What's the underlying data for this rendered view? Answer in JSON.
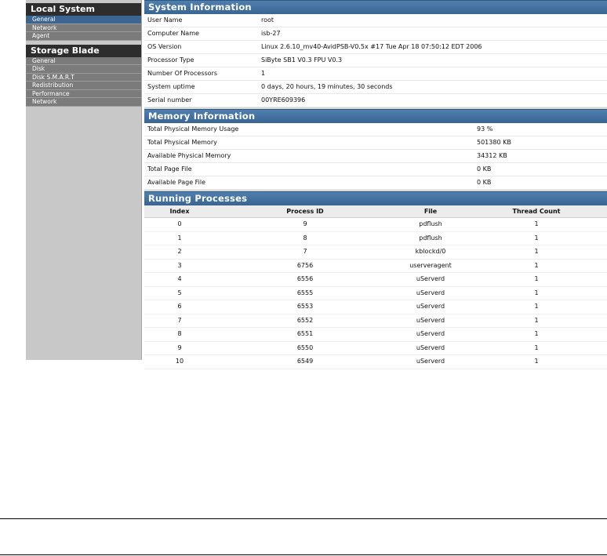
{
  "nav": {
    "local_system": {
      "heading": "Local System",
      "items": [
        {
          "label": "General",
          "active": true
        },
        {
          "label": "Network",
          "active": false
        },
        {
          "label": "Agent",
          "active": false
        }
      ]
    },
    "storage_blade": {
      "heading": "Storage Blade",
      "items": [
        {
          "label": "General"
        },
        {
          "label": "Disk"
        },
        {
          "label": "Disk S.M.A.R.T"
        },
        {
          "label": "Redistribution"
        },
        {
          "label": "Performance"
        },
        {
          "label": "Network"
        }
      ]
    }
  },
  "system_info": {
    "title": "System Information",
    "rows": [
      {
        "label": "User Name",
        "value": "root"
      },
      {
        "label": "Computer Name",
        "value": "isb-27"
      },
      {
        "label": "OS Version",
        "value": "Linux 2.6.10_mv40-AvidPSB-V0.5x #17 Tue Apr 18 07:50:12 EDT 2006"
      },
      {
        "label": "Processor Type",
        "value": "SiByte SB1 V0.3 FPU V0.3"
      },
      {
        "label": "Number Of Processors",
        "value": "1"
      },
      {
        "label": "System uptime",
        "value": "0 days, 20 hours, 19 minutes, 30 seconds"
      },
      {
        "label": "Serial number",
        "value": "00YRE609396"
      }
    ]
  },
  "memory_info": {
    "title": "Memory Information",
    "rows": [
      {
        "label": "Total Physical Memory Usage",
        "value": "93 %"
      },
      {
        "label": "Total Physical Memory",
        "value": "501380 KB"
      },
      {
        "label": "Available Physical Memory",
        "value": "34312 KB"
      },
      {
        "label": "Total Page File",
        "value": "0 KB"
      },
      {
        "label": "Available Page File",
        "value": "0 KB"
      }
    ]
  },
  "processes": {
    "title": "Running Processes",
    "columns": [
      "Index",
      "Process ID",
      "File",
      "Thread Count"
    ],
    "rows": [
      [
        "0",
        "9",
        "pdflush",
        "1"
      ],
      [
        "1",
        "8",
        "pdflush",
        "1"
      ],
      [
        "2",
        "7",
        "kblockd/0",
        "1"
      ],
      [
        "3",
        "6756",
        "userveragent",
        "1"
      ],
      [
        "4",
        "6556",
        "uServerd",
        "1"
      ],
      [
        "5",
        "6555",
        "uServerd",
        "1"
      ],
      [
        "6",
        "6553",
        "uServerd",
        "1"
      ],
      [
        "7",
        "6552",
        "uServerd",
        "1"
      ],
      [
        "8",
        "6551",
        "uServerd",
        "1"
      ],
      [
        "9",
        "6550",
        "uServerd",
        "1"
      ],
      [
        "10",
        "6549",
        "uServerd",
        "1"
      ]
    ]
  },
  "colors": {
    "panel_header": "#3f6b99",
    "nav_active": "#3d6591",
    "nav_item": "#7b7b7b",
    "nav_heading": "#2d2d2d"
  }
}
